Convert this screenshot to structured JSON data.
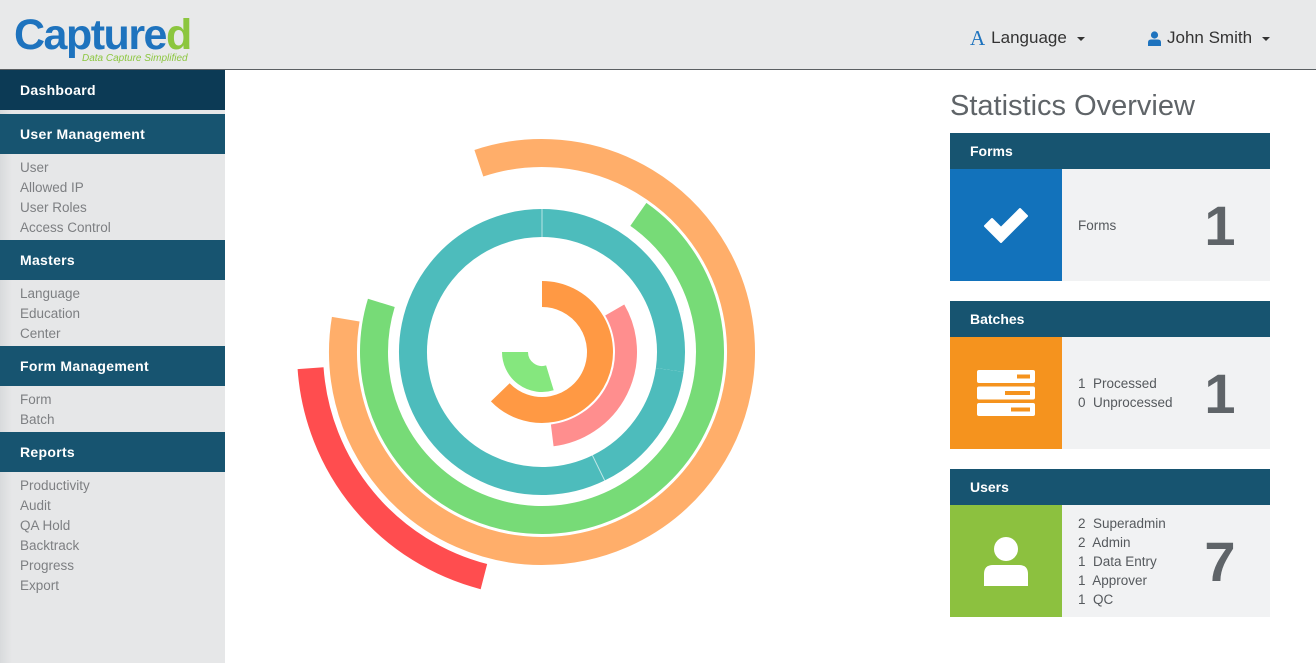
{
  "header": {
    "logo_text_main": "Capture",
    "logo_text_end": "d",
    "logo_tagline": "Data Capture Simplified",
    "language_label": "Language",
    "user_label": "John Smith"
  },
  "sidebar": {
    "dashboard": "Dashboard",
    "sections": [
      {
        "title": "User Management",
        "items": [
          "User",
          "Allowed IP",
          "User Roles",
          "Access Control"
        ]
      },
      {
        "title": "Masters",
        "items": [
          "Language",
          "Education",
          "Center"
        ]
      },
      {
        "title": "Form Management",
        "items": [
          "Form",
          "Batch"
        ]
      },
      {
        "title": "Reports",
        "items": [
          "Productivity",
          "Audit",
          "QA Hold",
          "Backtrack",
          "Progress",
          "Export"
        ]
      }
    ]
  },
  "stats": {
    "title": "Statistics Overview",
    "forms": {
      "title": "Forms",
      "lines": [
        "Forms"
      ],
      "count": "1",
      "color": "#1272bb",
      "icon": "check-icon"
    },
    "batches": {
      "title": "Batches",
      "lines": [
        "1  Processed",
        "0  Unprocessed"
      ],
      "count": "1",
      "color": "#f5931e",
      "icon": "server-icon"
    },
    "users": {
      "title": "Users",
      "lines": [
        "2  Superadmin",
        "2  Admin",
        "1  Data Entry",
        "1  Approver",
        "1  QC"
      ],
      "count": "7",
      "color": "#8cc13f",
      "icon": "user-icon"
    }
  },
  "colors": {
    "header_bg": "#e8e9ea",
    "sidebar_section": "#175470",
    "sidebar_dashboard": "#0c3a55",
    "ring_red": "#ff4d4f",
    "ring_light_orange": "#ffae6a",
    "ring_green": "#77db77",
    "ring_teal": "#4dbcbc",
    "ring_pink": "#ff8e8e",
    "ring_orange": "#ff9944",
    "ring_light_green": "#85e77e"
  },
  "chart_data": {
    "type": "radial-arcs",
    "arcs": [
      {
        "color": "#ff4d4f",
        "start": -165.5,
        "end": -94
      },
      {
        "color": "#ffae6a",
        "start": -18.5,
        "end": 279.5
      },
      {
        "color": "#77db77",
        "start": 35,
        "end": 287
      },
      {
        "color": "#4dbcbc",
        "start": 0,
        "end": 98
      },
      {
        "color": "#4dbcbc",
        "start": 98,
        "end": 154
      },
      {
        "color": "#4dbcbc",
        "start": 154,
        "end": 360
      },
      {
        "color": "#ff8e8e",
        "start": 60,
        "end": 173
      },
      {
        "color": "#ff9944",
        "start": 0,
        "end": 226
      },
      {
        "color": "#85e77e",
        "start": 163,
        "end": 270
      }
    ]
  }
}
